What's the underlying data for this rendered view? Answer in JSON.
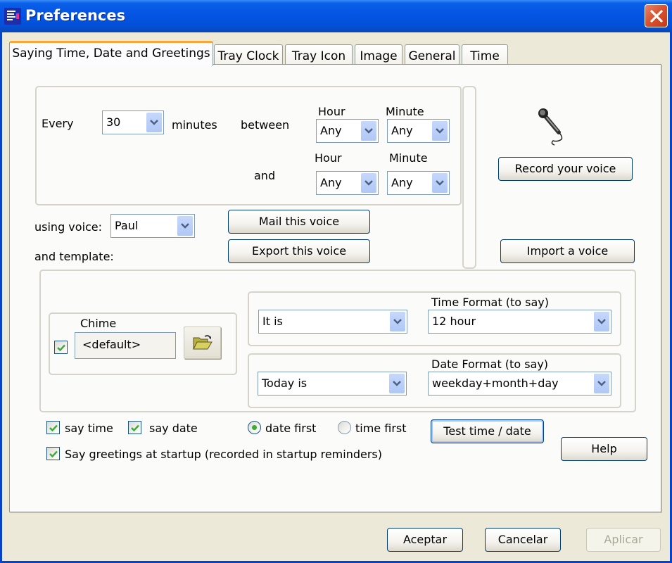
{
  "window": {
    "title": "Preferences",
    "close_icon": "close-x-icon"
  },
  "tabs": [
    {
      "label": "Saying Time, Date and Greetings",
      "active": true
    },
    {
      "label": "Tray Clock",
      "active": false
    },
    {
      "label": "Tray Icon",
      "active": false
    },
    {
      "label": "Image",
      "active": false
    },
    {
      "label": "General",
      "active": false
    },
    {
      "label": "Time",
      "active": false
    }
  ],
  "schedule": {
    "every_label": "Every",
    "every_value": "30",
    "minutes_label": "minutes",
    "between_label": "between",
    "and_label": "and",
    "start": {
      "hour_label": "Hour",
      "hour_value": "Any",
      "minute_label": "Minute",
      "minute_value": "Any"
    },
    "end": {
      "hour_label": "Hour",
      "hour_value": "Any",
      "minute_label": "Minute",
      "minute_value": "Any"
    }
  },
  "voice": {
    "using_voice_label": "using voice:",
    "voice_value": "Paul",
    "template_label": "and template:",
    "mail_button": "Mail this voice",
    "export_button": "Export this voice",
    "record_button": "Record your voice",
    "import_button": "Import a voice",
    "mic_icon": "microphone-icon"
  },
  "chime": {
    "label": "Chime",
    "checked": true,
    "value": "<default>",
    "browse_icon": "open-folder-icon"
  },
  "template": {
    "time_prefix_value": "It is",
    "time_format_label": "Time Format (to say)",
    "time_format_value": "12 hour",
    "date_prefix_value": "Today is",
    "date_format_label": "Date Format (to say)",
    "date_format_value": "weekday+month+day"
  },
  "options": {
    "say_time": {
      "label": "say time",
      "checked": true
    },
    "say_date": {
      "label": "say date",
      "checked": true
    },
    "date_first": {
      "label": "date first",
      "selected": true
    },
    "time_first": {
      "label": "time first",
      "selected": false
    },
    "greetings": {
      "label": "Say greetings at startup (recorded in startup reminders)",
      "checked": true
    },
    "test_button": "Test time / date",
    "help_button": "Help"
  },
  "footer": {
    "ok_button": "Aceptar",
    "cancel_button": "Cancelar",
    "apply_button": "Aplicar",
    "apply_enabled": false
  },
  "colors": {
    "titlebar": "#0554E3",
    "tab_highlight": "#F7A838",
    "check_mark": "#3EA83C",
    "close_button": "#D8502E"
  }
}
